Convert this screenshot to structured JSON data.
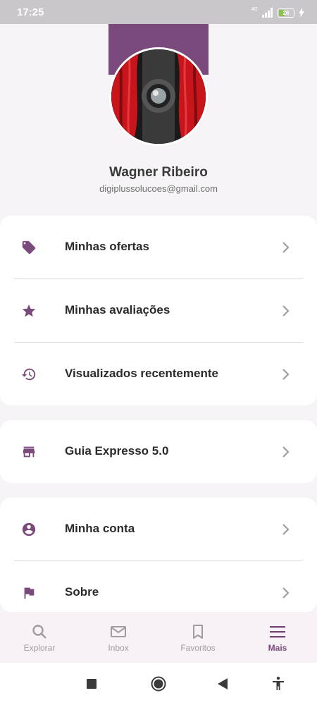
{
  "status_bar": {
    "time": "17:25",
    "network": "4G",
    "battery_level": "26"
  },
  "profile": {
    "name": "Wagner Ribeiro",
    "email": "digiplussolucoes@gmail.com"
  },
  "menu_group_1": [
    {
      "label": "Minhas ofertas",
      "icon": "tag-icon"
    },
    {
      "label": "Minhas avaliações",
      "icon": "star-icon"
    },
    {
      "label": "Visualizados recentemente",
      "icon": "history-icon"
    }
  ],
  "menu_group_2": [
    {
      "label": "Guia Expresso 5.0",
      "icon": "store-icon"
    }
  ],
  "menu_group_3": [
    {
      "label": "Minha conta",
      "icon": "account-circle-icon"
    },
    {
      "label": "Sobre",
      "icon": "flag-icon"
    }
  ],
  "bottom_nav": [
    {
      "label": "Explorar",
      "icon": "search-icon",
      "active": false
    },
    {
      "label": "Inbox",
      "icon": "mail-icon",
      "active": false
    },
    {
      "label": "Favoritos",
      "icon": "bookmark-icon",
      "active": false
    },
    {
      "label": "Mais",
      "icon": "menu-icon",
      "active": true
    }
  ],
  "colors": {
    "accent": "#7b4a7d",
    "inactive_nav": "#a39aa2",
    "background": "#f6f4f6"
  }
}
